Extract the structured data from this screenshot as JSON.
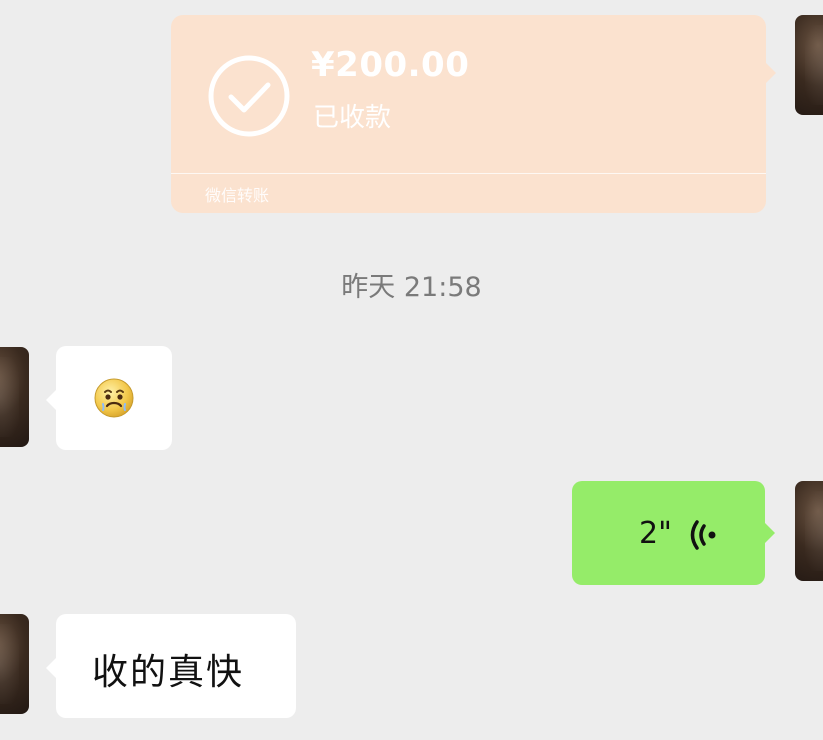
{
  "transfer": {
    "amount": "¥200.00",
    "status": "已收款",
    "footer": "微信转账"
  },
  "timestamp": "昨天  21:58",
  "messages": {
    "incoming_emoji": "worried-face",
    "outgoing_voice_duration": "2\"",
    "incoming_text": "收的真快"
  },
  "colors": {
    "background": "#ededed",
    "transfer_card": "#fbe2cf",
    "outgoing_bubble": "#95ec69",
    "incoming_bubble": "#ffffff",
    "timestamp_text": "#7a7a7a"
  }
}
